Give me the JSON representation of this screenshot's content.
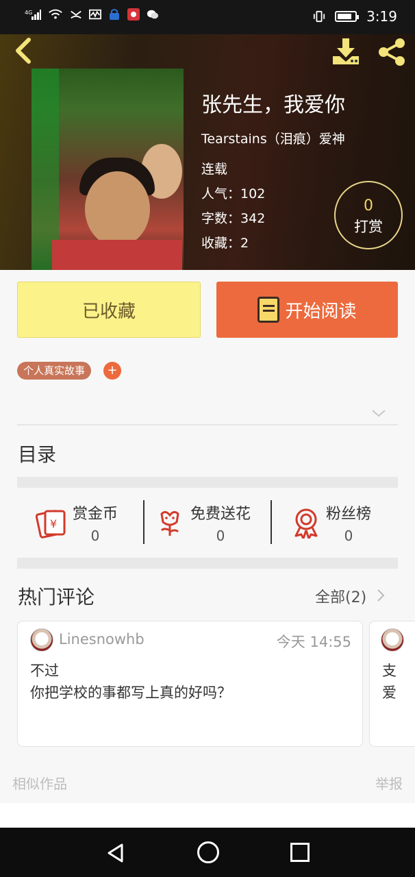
{
  "status_bar": {
    "network": "4G",
    "time": "3:19",
    "icons": [
      "signal-icon",
      "wifi-icon",
      "missed-call-icon",
      "activity-icon",
      "lock-app-icon",
      "huawei-icon",
      "wechat-icon",
      "vibrate-icon",
      "battery-icon"
    ],
    "battery_level": 0.85
  },
  "header": {
    "back_icon": "chevron-left-icon",
    "download_icon": "download-icon",
    "share_icon": "share-icon"
  },
  "book": {
    "title": "张先生，我爱你",
    "author": "Tearstains（泪痕）爱神",
    "status": "连载",
    "popularity_label": "人气：",
    "popularity": "102",
    "words_label": "字数：",
    "words": "342",
    "favorites_label": "收藏：",
    "favorites": "2",
    "tip_count": "0",
    "tip_label": "打赏"
  },
  "actions": {
    "favorited_label": "已收藏",
    "read_label": "开始阅读"
  },
  "tags": {
    "items": [
      "个人真实故事"
    ],
    "add_label": "+"
  },
  "catalog_label": "目录",
  "stats": [
    {
      "label": "赏金币",
      "value": "0",
      "icon": "red-envelope-icon"
    },
    {
      "label": "免费送花",
      "value": "0",
      "icon": "flower-icon"
    },
    {
      "label": "粉丝榜",
      "value": "0",
      "icon": "medal-icon"
    }
  ],
  "comments": {
    "title": "热门评论",
    "all_label": "全部(2)",
    "items": [
      {
        "user": "Linesnowhb",
        "time": "今天 14:55",
        "lines": [
          "不过",
          "你把学校的事都写上真的好吗？"
        ]
      },
      {
        "user": "",
        "time": "",
        "lines": [
          "支",
          "爱"
        ]
      }
    ]
  },
  "footer": {
    "similar_label": "相似作品",
    "report_label": "举报"
  },
  "colors": {
    "accent_orange": "#ec6a3d",
    "favorited_yellow": "#fbf28a",
    "tag_brown": "#c87559",
    "icon_red": "#d23a2a",
    "header_gold": "#f1d36a"
  }
}
